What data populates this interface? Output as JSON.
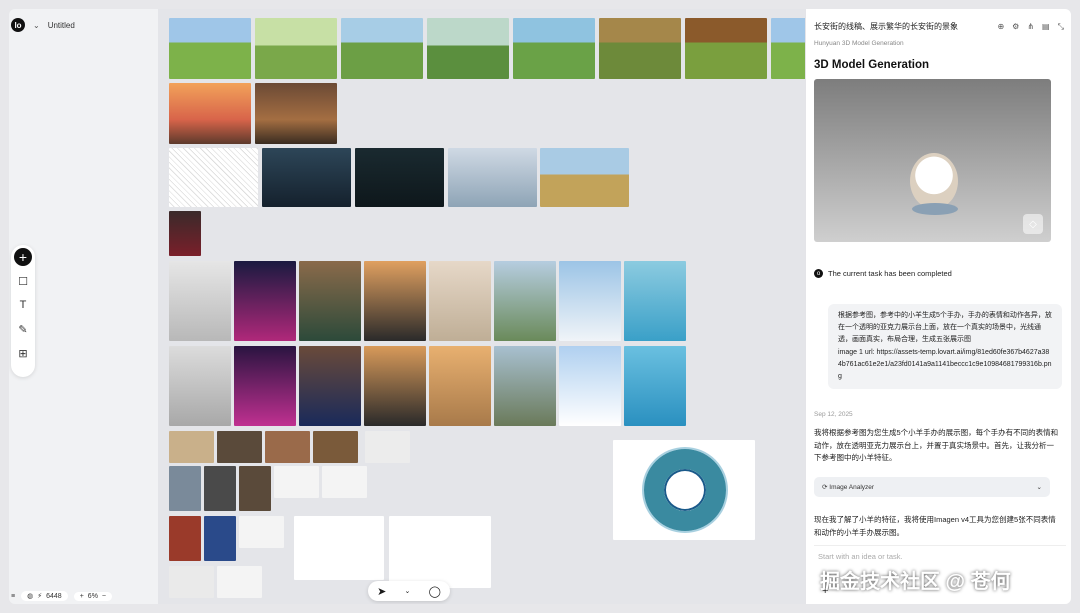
{
  "app": {
    "title": "Untitled"
  },
  "panel": {
    "title": "长安街的线稿、展示繁华的长安街的景象",
    "subtitle": "Hunyuan 3D Model Generation",
    "heading": "3D Model Generation",
    "status": "The current task has been completed",
    "user_message": "根据参考图，参考中的小羊生成5个手办，手办的表情和动作各异，放在一个透明的亚克力展示台上面，放在一个真实的场景中，光线通透，画面真实，布局合理，生成五张展示图\nimage 1 url: https://assets-temp.lovart.ai/img/81ed60fe367b4627a384b761ac61e2e1/a23fd0141a9a1141beccc1c9e10984681799316b.png",
    "date": "Sep 12, 2025",
    "reply": "我将根据参考图为您生成5个小羊手办的展示图，每个手办有不同的表情和动作，放在透明亚克力展示台上，并置于真实场景中。首先，让我分析一下参考图中的小羊特征。",
    "tool_label": "Image Analyzer",
    "reply2": "现在我了解了小羊的特征，我将使用Imagen v4工具为您创建5张不同表情和动作的小羊手办展示图。",
    "input_placeholder": "Start with an idea or task."
  },
  "bottom": {
    "credits": "6448",
    "zoom": "6%"
  },
  "watermark": "掘金技术社区 @ 苍何",
  "icons": {
    "logo": "lovart-logo-icon",
    "add": "plus-icon",
    "square": "square-icon",
    "text": "text-icon",
    "pen": "pen-icon",
    "layout": "layout-icon",
    "cursor": "cursor-icon",
    "chat": "chat-bubble-icon"
  }
}
